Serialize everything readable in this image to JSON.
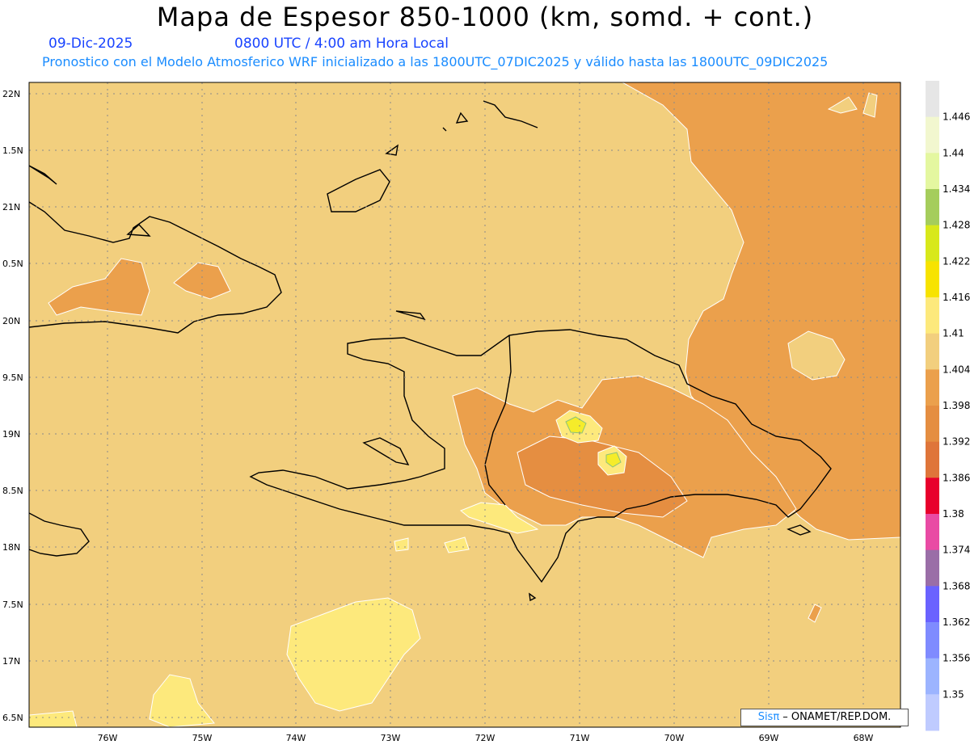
{
  "header": {
    "title": "Mapa de Espesor 850-1000 (km, somd. + cont.)",
    "date": "09-Dic-2025",
    "time": "0800 UTC / 4:00 am Hora Local",
    "subtitle": "Pronostico con el Modelo Atmosferico WRF inicializado a las 1800UTC_07DIC2025 y válido hasta las  1800UTC_09DIC2025"
  },
  "map": {
    "lat_labels": [
      "22N",
      "1.5N",
      "21N",
      "0.5N",
      "20N",
      "9.5N",
      "19N",
      "8.5N",
      "18N",
      "7.5N",
      "17N",
      "6.5N"
    ],
    "lon_labels": [
      "76W",
      "75W",
      "74W",
      "73W",
      "72W",
      "71W",
      "70W",
      "69W",
      "68W"
    ],
    "colors": {
      "ocean_base": "#f2cf7e",
      "warm_region": "#eba04c",
      "warmer_region": "#e58e41",
      "light_region": "#fde97c",
      "peak_yellow": "#f5ec2a",
      "coast": "#000000",
      "contour": "#ffffff",
      "grid": "#8a8a8a"
    }
  },
  "colorbar": {
    "labels": [
      "1.446",
      "1.44",
      "1.434",
      "1.428",
      "1.422",
      "1.416",
      "1.41",
      "1.404",
      "1.398",
      "1.392",
      "1.386",
      "1.38",
      "1.374",
      "1.368",
      "1.362",
      "1.356",
      "1.35"
    ],
    "colors": [
      "#e6e6e6",
      "#f2f7cf",
      "#e4f7a0",
      "#a5cd5c",
      "#d8e81b",
      "#f7e300",
      "#fde97c",
      "#f2cf7e",
      "#eba04c",
      "#e58e41",
      "#df753a",
      "#e8002c",
      "#e94ba4",
      "#9a6ea7",
      "#6a62ff",
      "#7f8bff",
      "#9cb4ff",
      "#bfcbff"
    ]
  },
  "credit": {
    "sis": "Sisπ",
    "rest": " – ONAMET/REP.DOM."
  }
}
